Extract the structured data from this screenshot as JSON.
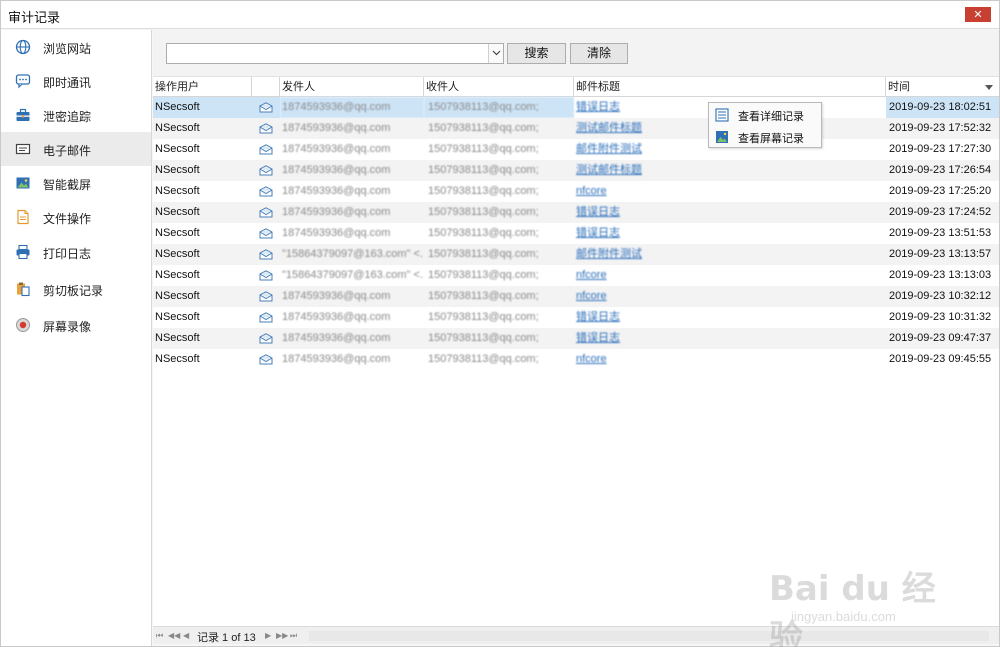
{
  "window": {
    "title": "审计记录",
    "close_glyph": "✕"
  },
  "sidebar": {
    "items": [
      {
        "label": "浏览网站",
        "icon": "globe-icon",
        "active": false
      },
      {
        "label": "即时通讯",
        "icon": "chat-icon",
        "active": false
      },
      {
        "label": "泄密追踪",
        "icon": "toolbox-icon",
        "active": false
      },
      {
        "label": "电子邮件",
        "icon": "email-icon",
        "active": true
      },
      {
        "label": "智能截屏",
        "icon": "picture-icon",
        "active": false
      },
      {
        "label": "文件操作",
        "icon": "file-icon",
        "active": false
      },
      {
        "label": "打印日志",
        "icon": "printer-icon",
        "active": false
      },
      {
        "label": "剪切板记录",
        "icon": "clipboard-icon",
        "active": false
      },
      {
        "label": "屏幕录像",
        "icon": "record-icon",
        "active": false
      }
    ]
  },
  "toolbar": {
    "search_value": "",
    "search_placeholder": "",
    "search_label": "搜索",
    "clear_label": "清除"
  },
  "grid": {
    "columns": {
      "user": "操作用户",
      "from": "发件人",
      "to": "收件人",
      "subject": "邮件标题",
      "time": "时间"
    },
    "rows": [
      {
        "user": "NSecsoft",
        "from": "1874593936@qq.com",
        "to": "1507938113@qq.com;",
        "subject": "错误日志",
        "time": "2019-09-23 18:02:51"
      },
      {
        "user": "NSecsoft",
        "from": "1874593936@qq.com",
        "to": "1507938113@qq.com;",
        "subject": "测试邮件标题",
        "time": "2019-09-23 17:52:32"
      },
      {
        "user": "NSecsoft",
        "from": "1874593936@qq.com",
        "to": "1507938113@qq.com;",
        "subject": "邮件附件测试",
        "time": "2019-09-23 17:27:30"
      },
      {
        "user": "NSecsoft",
        "from": "1874593936@qq.com",
        "to": "1507938113@qq.com;",
        "subject": "测试邮件标题",
        "time": "2019-09-23 17:26:54"
      },
      {
        "user": "NSecsoft",
        "from": "1874593936@qq.com",
        "to": "1507938113@qq.com;",
        "subject": "nfcore",
        "time": "2019-09-23 17:25:20"
      },
      {
        "user": "NSecsoft",
        "from": "1874593936@qq.com",
        "to": "1507938113@qq.com;",
        "subject": "错误日志",
        "time": "2019-09-23 17:24:52"
      },
      {
        "user": "NSecsoft",
        "from": "1874593936@qq.com",
        "to": "1507938113@qq.com;",
        "subject": "错误日志",
        "time": "2019-09-23 13:51:53"
      },
      {
        "user": "NSecsoft",
        "from": "\"15864379097@163.com\" <...",
        "to": "1507938113@qq.com;",
        "subject": "邮件附件测试",
        "time": "2019-09-23 13:13:57"
      },
      {
        "user": "NSecsoft",
        "from": "\"15864379097@163.com\" <...",
        "to": "1507938113@qq.com;",
        "subject": "nfcore",
        "time": "2019-09-23 13:13:03"
      },
      {
        "user": "NSecsoft",
        "from": "1874593936@qq.com",
        "to": "1507938113@qq.com;",
        "subject": "nfcore",
        "time": "2019-09-23 10:32:12"
      },
      {
        "user": "NSecsoft",
        "from": "1874593936@qq.com",
        "to": "1507938113@qq.com;",
        "subject": "错误日志",
        "time": "2019-09-23 10:31:32"
      },
      {
        "user": "NSecsoft",
        "from": "1874593936@qq.com",
        "to": "1507938113@qq.com;",
        "subject": "错误日志",
        "time": "2019-09-23 09:47:37"
      },
      {
        "user": "NSecsoft",
        "from": "1874593936@qq.com",
        "to": "1507938113@qq.com;",
        "subject": "nfcore",
        "time": "2019-09-23 09:45:55"
      }
    ]
  },
  "context_menu": {
    "items": [
      {
        "label": "查看详细记录",
        "icon": "details-list-icon"
      },
      {
        "label": "查看屏幕记录",
        "icon": "screenshot-icon"
      }
    ]
  },
  "pager": {
    "label": "记录 1 of 13"
  },
  "watermark": {
    "text": "Bai du 经验",
    "sub": "jingyan.baidu.com"
  },
  "colors": {
    "accent": "#2a6ebb",
    "selected_row": "#cde4f7",
    "close": "#c84031"
  }
}
